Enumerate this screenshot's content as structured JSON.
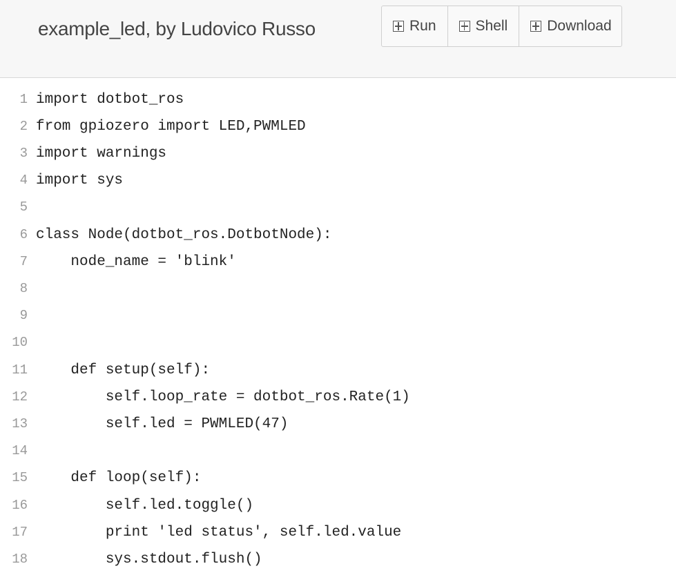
{
  "header": {
    "title": "example_led, by Ludovico Russo",
    "buttons": [
      {
        "label": "Run",
        "icon": "run-icon"
      },
      {
        "label": "Shell",
        "icon": "shell-icon"
      },
      {
        "label": "Download",
        "icon": "download-icon"
      }
    ]
  },
  "editor": {
    "lines": [
      {
        "num": "1",
        "code": "import dotbot_ros"
      },
      {
        "num": "2",
        "code": "from gpiozero import LED,PWMLED"
      },
      {
        "num": "3",
        "code": "import warnings"
      },
      {
        "num": "4",
        "code": "import sys"
      },
      {
        "num": "5",
        "code": ""
      },
      {
        "num": "6",
        "code": "class Node(dotbot_ros.DotbotNode):"
      },
      {
        "num": "7",
        "code": "    node_name = 'blink'"
      },
      {
        "num": "8",
        "code": ""
      },
      {
        "num": "9",
        "code": ""
      },
      {
        "num": "10",
        "code": ""
      },
      {
        "num": "11",
        "code": "    def setup(self):"
      },
      {
        "num": "12",
        "code": "        self.loop_rate = dotbot_ros.Rate(1)"
      },
      {
        "num": "13",
        "code": "        self.led = PWMLED(47)"
      },
      {
        "num": "14",
        "code": ""
      },
      {
        "num": "15",
        "code": "    def loop(self):"
      },
      {
        "num": "16",
        "code": "        self.led.toggle()"
      },
      {
        "num": "17",
        "code": "        print 'led status', self.led.value"
      },
      {
        "num": "18",
        "code": "        sys.stdout.flush()"
      }
    ]
  }
}
